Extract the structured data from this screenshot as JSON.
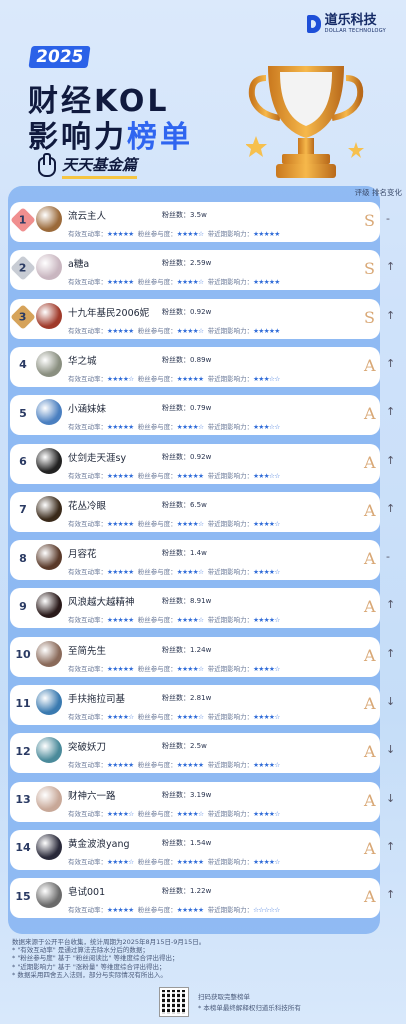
{
  "brand": {
    "name": "道乐科技",
    "subname": "DOLLAR TECHNOLOGY"
  },
  "header": {
    "year": "2025",
    "title_line1": "财经KOL",
    "title_line2_a": "影响力",
    "title_line2_b": "榜单",
    "subtitle": "天天基金篇"
  },
  "table_header": "评级 排名变化",
  "metric_labels": {
    "fans": "粉丝数：",
    "interaction": "有效互动率：",
    "participation": "粉丝参与度：",
    "influence": "带近期影响力："
  },
  "rows": [
    {
      "rank": "1",
      "name": "流云主人",
      "fans": "3.5w",
      "s1": "★★★★★",
      "s2": "★★★★☆",
      "s3": "★★★★★",
      "grade": "S",
      "change": "-",
      "avatar": "#9b6a3a"
    },
    {
      "rank": "2",
      "name": "a糖a",
      "fans": "2.59w",
      "s1": "★★★★★",
      "s2": "★★★★☆",
      "s3": "★★★★★",
      "grade": "S",
      "change": "↑",
      "avatar": "#c9b6c0"
    },
    {
      "rank": "3",
      "name": "十九年基民2006妮",
      "fans": "0.92w",
      "s1": "★★★★★",
      "s2": "★★★★☆",
      "s3": "★★★★★",
      "grade": "S",
      "change": "↑",
      "avatar": "#a03a2a"
    },
    {
      "rank": "4",
      "name": "华之城",
      "fans": "0.89w",
      "s1": "★★★★☆",
      "s2": "★★★★★",
      "s3": "★★★☆☆",
      "grade": "A",
      "change": "↑",
      "avatar": "#8a8f80"
    },
    {
      "rank": "5",
      "name": "小涵妹妹",
      "fans": "0.79w",
      "s1": "★★★★★",
      "s2": "★★★★☆",
      "s3": "★★★☆☆",
      "grade": "A",
      "change": "↑",
      "avatar": "#4a7fc0"
    },
    {
      "rank": "6",
      "name": "仗剑走天涯sy",
      "fans": "0.92w",
      "s1": "★★★★★",
      "s2": "★★★★★",
      "s3": "★★★☆☆",
      "grade": "A",
      "change": "↑",
      "avatar": "#222222"
    },
    {
      "rank": "7",
      "name": "花丛冷眼",
      "fans": "6.5w",
      "s1": "★★★★★",
      "s2": "★★★★☆",
      "s3": "★★★★☆",
      "grade": "A",
      "change": "↑",
      "avatar": "#3a2a1a"
    },
    {
      "rank": "8",
      "name": "月容花",
      "fans": "1.4w",
      "s1": "★★★★★",
      "s2": "★★★★☆",
      "s3": "★★★★☆",
      "grade": "A",
      "change": "-",
      "avatar": "#5a3a2a"
    },
    {
      "rank": "9",
      "name": "风浪越大越精神",
      "fans": "8.91w",
      "s1": "★★★★★",
      "s2": "★★★★☆",
      "s3": "★★★★☆",
      "grade": "A",
      "change": "↑",
      "avatar": "#2a1a1a"
    },
    {
      "rank": "10",
      "name": "至简先生",
      "fans": "1.24w",
      "s1": "★★★★★",
      "s2": "★★★★☆",
      "s3": "★★★★☆",
      "grade": "A",
      "change": "↑",
      "avatar": "#8a6a5a"
    },
    {
      "rank": "11",
      "name": "手扶拖拉司基",
      "fans": "2.81w",
      "s1": "★★★★☆",
      "s2": "★★★★☆",
      "s3": "★★★★☆",
      "grade": "A",
      "change": "↓",
      "avatar": "#3a7ab0"
    },
    {
      "rank": "12",
      "name": "突破妖刀",
      "fans": "2.5w",
      "s1": "★★★★★",
      "s2": "★★★★★",
      "s3": "★★★★☆",
      "grade": "A",
      "change": "↓",
      "avatar": "#4a8a9a"
    },
    {
      "rank": "13",
      "name": "财神六一路",
      "fans": "3.19w",
      "s1": "★★★★☆",
      "s2": "★★★★☆",
      "s3": "★★★★☆",
      "grade": "A",
      "change": "↓",
      "avatar": "#c8a898"
    },
    {
      "rank": "14",
      "name": "黄金波浪yang",
      "fans": "1.54w",
      "s1": "★★★★☆",
      "s2": "★★★★★",
      "s3": "★★★★☆",
      "grade": "A",
      "change": "↑",
      "avatar": "#2a2a3a"
    },
    {
      "rank": "15",
      "name": "皂试001",
      "fans": "1.22w",
      "s1": "★★★★★",
      "s2": "★★★★★",
      "s3": "☆☆☆☆☆",
      "grade": "A",
      "change": "↑",
      "avatar": "#6a6a6a"
    }
  ],
  "notes": [
    "数据来源于公开平台收集，统计周期为2025年8月15日-9月15日。",
    "* \"有效互动率\" 是通过算法去除水分后的数据；",
    "* \"粉丝参与度\" 基于 \"粉丝阅读比\" 等维度综合评出得出；",
    "* \"近期影响力\" 基于 \"涨粉量\" 等维度综合评出得出；",
    "* 数据采用四舍五入法则，部分与实际情况有所出入。"
  ],
  "footer": {
    "qr_label": "扫码获取完整榜单",
    "copyright": "* 本榜单最终解释权归道乐科技所有"
  }
}
